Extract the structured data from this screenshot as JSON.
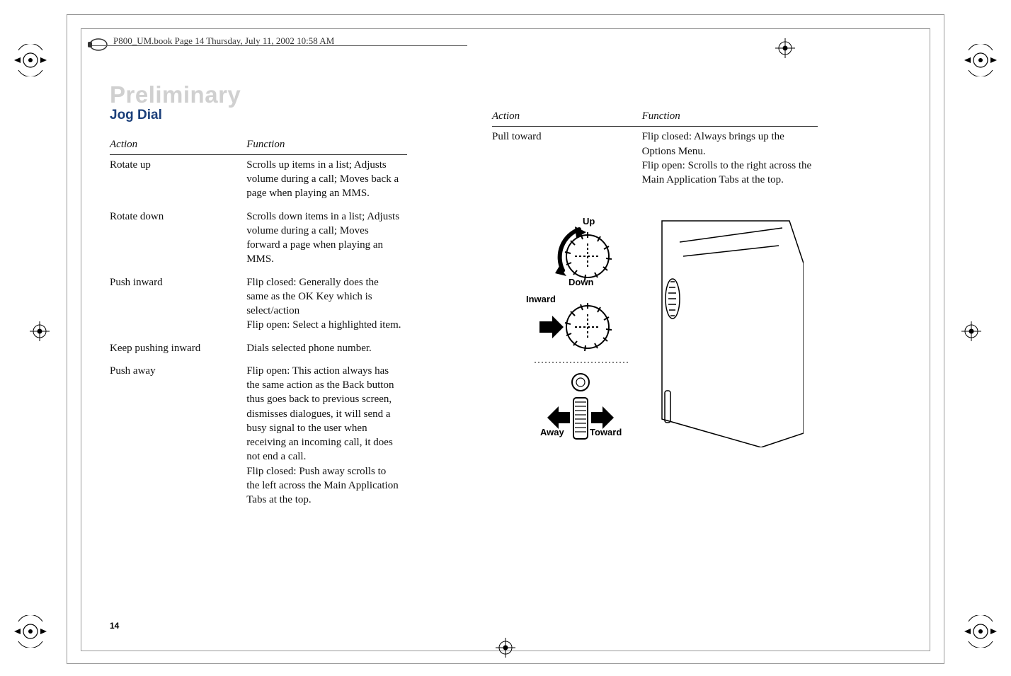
{
  "header": "P800_UM.book  Page 14  Thursday, July 11, 2002  10:58 AM",
  "watermark": "Preliminary",
  "page_number": "14",
  "left": {
    "title": "Jog Dial",
    "th_action": "Action",
    "th_function": "Function",
    "rows": [
      {
        "action": "Rotate up",
        "function": "Scrolls up items in a list; Adjusts volume during a call; Moves back a page when playing an MMS."
      },
      {
        "action": "Rotate down",
        "function": "Scrolls down items in a list; Adjusts volume during a call; Moves forward a page when playing an MMS."
      },
      {
        "action": "Push inward",
        "function": "Flip closed: Generally does the same as the OK Key which is select/action\nFlip open: Select a highlighted item."
      },
      {
        "action": "Keep pushing inward",
        "function": "Dials selected phone number."
      },
      {
        "action": "Push away",
        "function": "Flip open: This action always has the same action as the Back button thus goes back to previous screen, dismisses dialogues, it will send a busy signal to the user when receiving an incoming call, it does not end a call.\nFlip closed: Push away scrolls to the left across the Main Application Tabs at the top."
      }
    ]
  },
  "right": {
    "th_action": "Action",
    "th_function": "Function",
    "rows": [
      {
        "action": "Pull toward",
        "function": "Flip closed: Always brings up the Options Menu.\nFlip open: Scrolls to the right across the Main Application Tabs at the top."
      }
    ],
    "labels": {
      "up": "Up",
      "down": "Down",
      "inward": "Inward",
      "away": "Away",
      "toward": "Toward"
    }
  }
}
